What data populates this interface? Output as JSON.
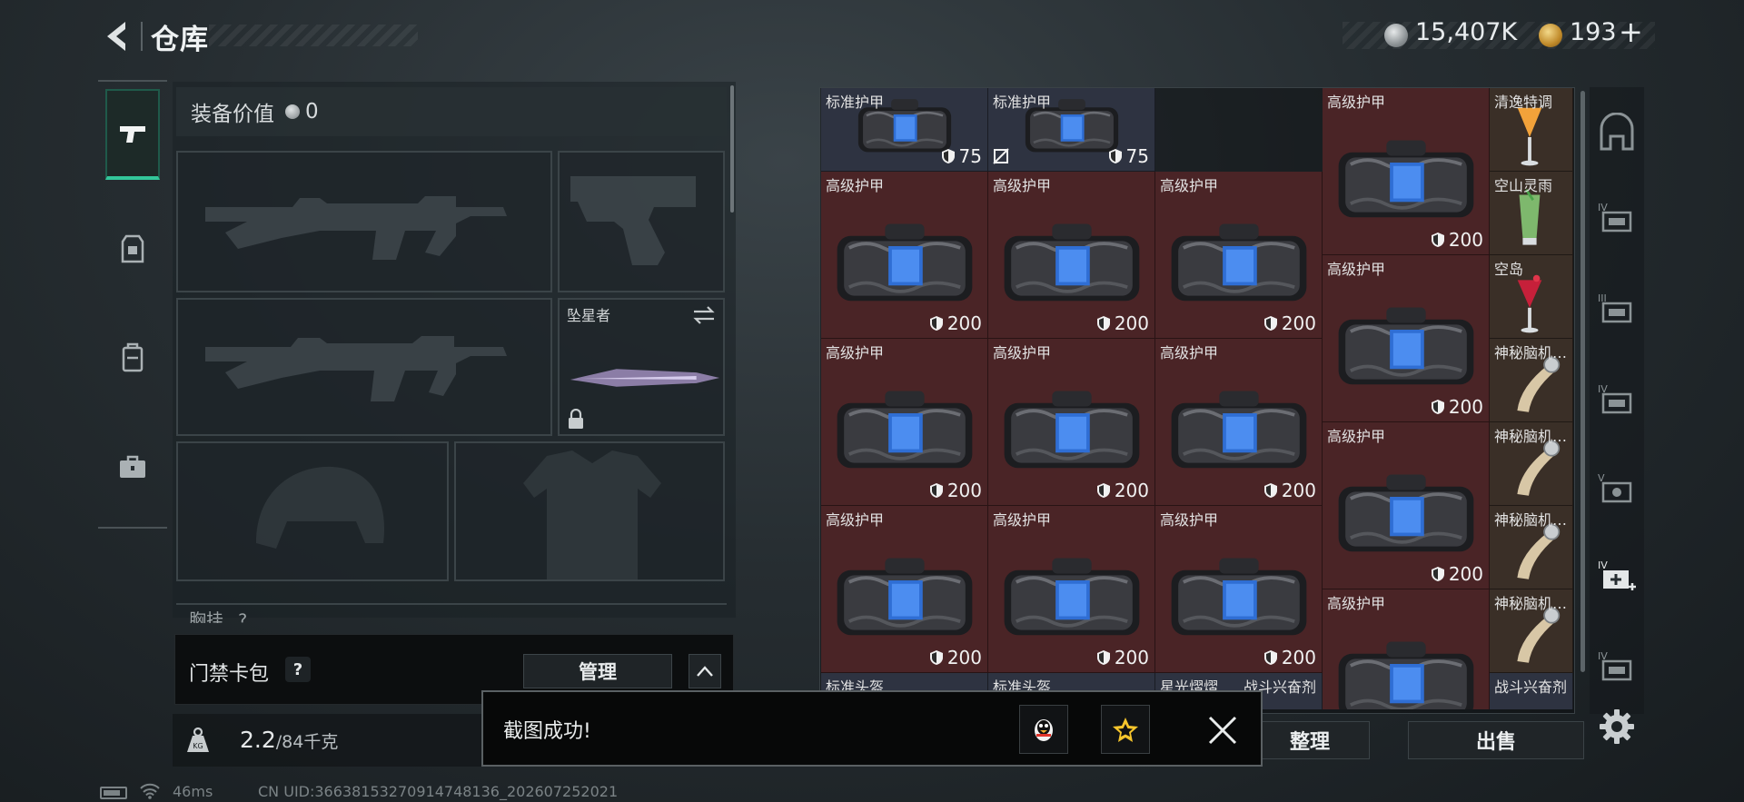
{
  "header": {
    "title": "仓库",
    "silver": "15,407K",
    "gold": "193",
    "plus": "+"
  },
  "nav": {
    "items": [
      {
        "name": "weapons",
        "icon": "pistol-icon",
        "active": true
      },
      {
        "name": "armor",
        "icon": "armor-vest-icon",
        "active": false
      },
      {
        "name": "backpack",
        "icon": "backpack-icon",
        "active": false
      },
      {
        "name": "toolbox",
        "icon": "toolbox-icon",
        "active": false
      }
    ]
  },
  "loadout": {
    "equip_value_label": "装备价值",
    "equip_value": "0",
    "melee_name": "坠星者",
    "chest_rig_label": "胸挂",
    "chest_rig_hint": "?",
    "card_pack_label": "门禁卡包",
    "card_pack_help": "?",
    "manage_label": "管理",
    "weight_value": "2.2",
    "weight_max": "/84千克"
  },
  "inventory": {
    "cells": [
      {
        "name": "标准护甲",
        "dur": "75",
        "color": "gray"
      },
      {
        "name": "标准护甲",
        "dur": "75",
        "color": "gray"
      },
      {
        "name": "高级护甲",
        "dur": "200",
        "color": "red"
      },
      {
        "name": "清逸特调",
        "color": "brown"
      },
      {
        "name": "高级护甲",
        "dur": "200",
        "color": "red"
      },
      {
        "name": "高级护甲",
        "dur": "200",
        "color": "red"
      },
      {
        "name": "高级护甲",
        "dur": "200",
        "color": "red"
      },
      {
        "name": "空山灵雨",
        "color": "brown"
      },
      {
        "name": "高级护甲",
        "dur": "200",
        "color": "red"
      },
      {
        "name": "空岛",
        "color": "brown"
      },
      {
        "name": "高级护甲",
        "dur": "200",
        "color": "red"
      },
      {
        "name": "高级护甲",
        "dur": "200",
        "color": "red"
      },
      {
        "name": "高级护甲",
        "dur": "200",
        "color": "red"
      },
      {
        "name": "神秘脑机…",
        "color": "brown"
      },
      {
        "name": "高级护甲",
        "dur": "200",
        "color": "red"
      },
      {
        "name": "神秘脑机…",
        "color": "brown"
      },
      {
        "name": "高级护甲",
        "dur": "200",
        "color": "red"
      },
      {
        "name": "高级护甲",
        "dur": "200",
        "color": "red"
      },
      {
        "name": "高级护甲",
        "dur": "200",
        "color": "red"
      },
      {
        "name": "神秘脑机…",
        "color": "brown"
      },
      {
        "name": "高级护甲",
        "color": "red"
      },
      {
        "name": "神秘脑机…",
        "color": "brown"
      },
      {
        "name": "标准头盔",
        "color": "gray"
      },
      {
        "name": "标准头盔",
        "color": "gray"
      },
      {
        "name": "星光熠熠",
        "color": "gray"
      },
      {
        "name": "战斗兴奋剂",
        "color": "gray"
      },
      {
        "name": "战斗兴奋剂",
        "color": "gray"
      }
    ]
  },
  "actions": {
    "sort_label": "整理",
    "sell_label": "出售"
  },
  "toast": {
    "message": "截图成功!"
  },
  "status": {
    "ping": "46ms",
    "uid": "CN UID:3663815327091474813​6_202607252021"
  },
  "colors": {
    "accent": "#33c79a",
    "cell_gray": "#2e3341",
    "cell_red": "#4a2426",
    "cell_brown": "#3a2f27"
  }
}
